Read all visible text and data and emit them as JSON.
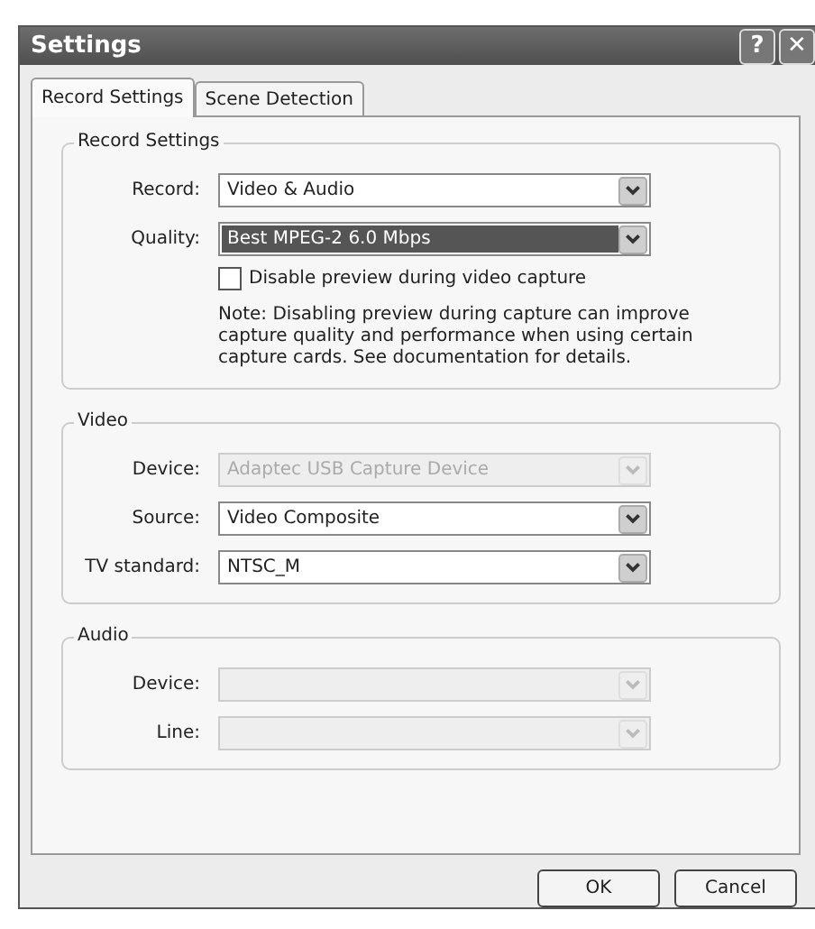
{
  "window": {
    "title": "Settings",
    "buttons": [
      "?",
      "✕"
    ]
  },
  "tabs": [
    {
      "label": "Record Settings",
      "selected": true
    },
    {
      "label": "Scene Detection",
      "selected": false
    }
  ],
  "groups": [
    {
      "title": "Record Settings",
      "fields": [
        {
          "label": "Record:",
          "value": "Video & Audio",
          "disabled": false,
          "selected": false
        },
        {
          "label": "Quality:",
          "value": "Best MPEG-2 6.0 Mbps",
          "disabled": false,
          "selected": true
        }
      ],
      "checkbox": {
        "label": "Disable preview during video capture",
        "checked": false
      },
      "note": "Note: Disabling preview during capture can improve capture quality and  performance  when using certain capture cards. See documentation for details."
    },
    {
      "title": "Video",
      "fields": [
        {
          "label": "Device:",
          "value": "Adaptec USB Capture Device",
          "disabled": true,
          "selected": false
        },
        {
          "label": "Source:",
          "value": "Video Composite",
          "disabled": false,
          "selected": false
        },
        {
          "label": "TV standard:",
          "value": "NTSC_M",
          "disabled": false,
          "selected": false
        }
      ]
    },
    {
      "title": "Audio",
      "fields": [
        {
          "label": "Device:",
          "disabled": true,
          "selected": false
        },
        {
          "label": "Line:",
          "disabled": true,
          "selected": false
        }
      ]
    }
  ],
  "buttons": [
    "OK",
    "Cancel"
  ]
}
